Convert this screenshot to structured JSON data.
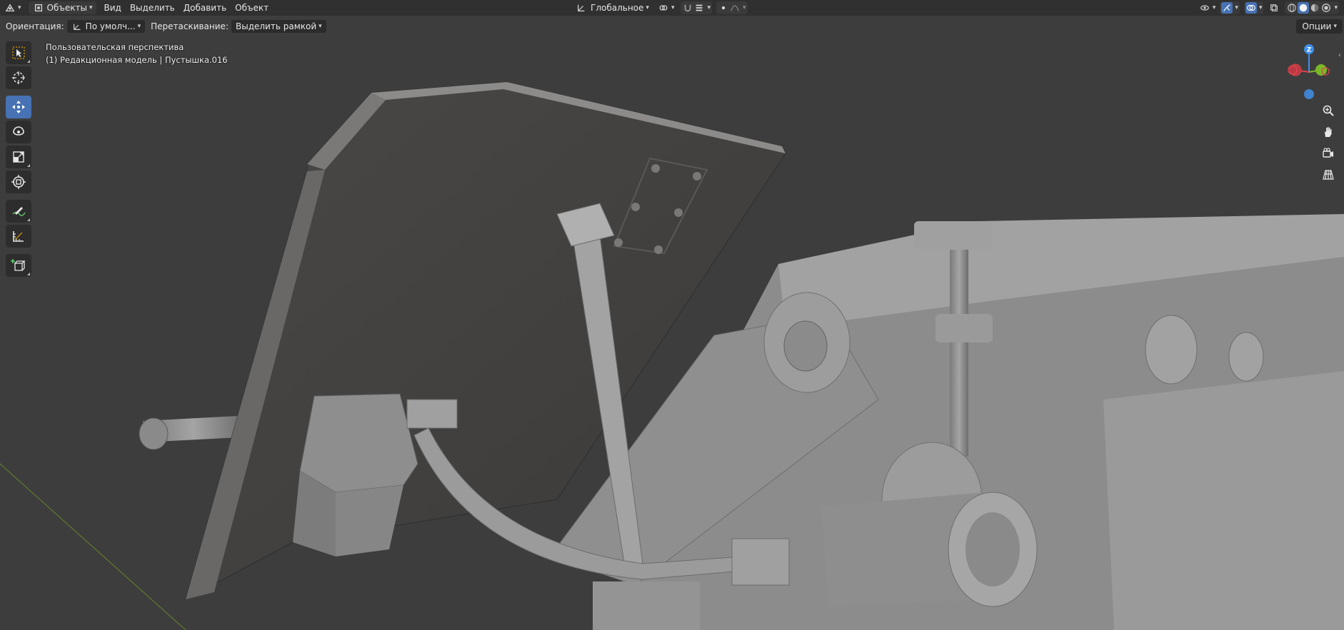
{
  "header": {
    "editor_type_icon": "viewport-editor-icon",
    "mode_label": "Объекты",
    "menus": [
      "Вид",
      "Выделить",
      "Добавить",
      "Объект"
    ],
    "transform_orientation": "Глобальное",
    "icons_right": [
      "visibility-icon",
      "gizmo-icon",
      "overlay-icon",
      "xray-icon",
      "wireframe-shading-icon",
      "solid-shading-icon",
      "material-shading-icon",
      "rendered-shading-icon"
    ]
  },
  "toolbar2": {
    "orientation_label": "Ориентация:",
    "orientation_value": "По умолч...",
    "drag_label": "Перетаскивание:",
    "drag_value": "Выделить рамкой",
    "options_label": "Опции"
  },
  "tools": [
    {
      "name": "select-box-tool",
      "icon": "select-box-icon",
      "active": false
    },
    {
      "name": "cursor-tool",
      "icon": "cursor-icon",
      "active": false
    },
    {
      "name": "move-tool",
      "icon": "move-icon",
      "active": true
    },
    {
      "name": "rotate-tool",
      "icon": "rotate-icon",
      "active": false
    },
    {
      "name": "scale-tool",
      "icon": "scale-icon",
      "active": false
    },
    {
      "name": "transform-tool",
      "icon": "transform-icon",
      "active": false
    },
    {
      "name": "annotate-tool",
      "icon": "annotate-icon",
      "active": false
    },
    {
      "name": "measure-tool",
      "icon": "measure-icon",
      "active": false
    },
    {
      "name": "add-cube-tool",
      "icon": "add-cube-icon",
      "active": false
    }
  ],
  "viewport": {
    "view_name": "Пользовательская перспектива",
    "object_info": "(1) Редакционная модель | Пустышка.016",
    "axis_labels": {
      "z": "Z"
    },
    "colors": {
      "x_axis": "#e0434d",
      "y_axis": "#7ab82a",
      "z_axis": "#3f8fe8",
      "active_tool": "#4772b3"
    }
  }
}
